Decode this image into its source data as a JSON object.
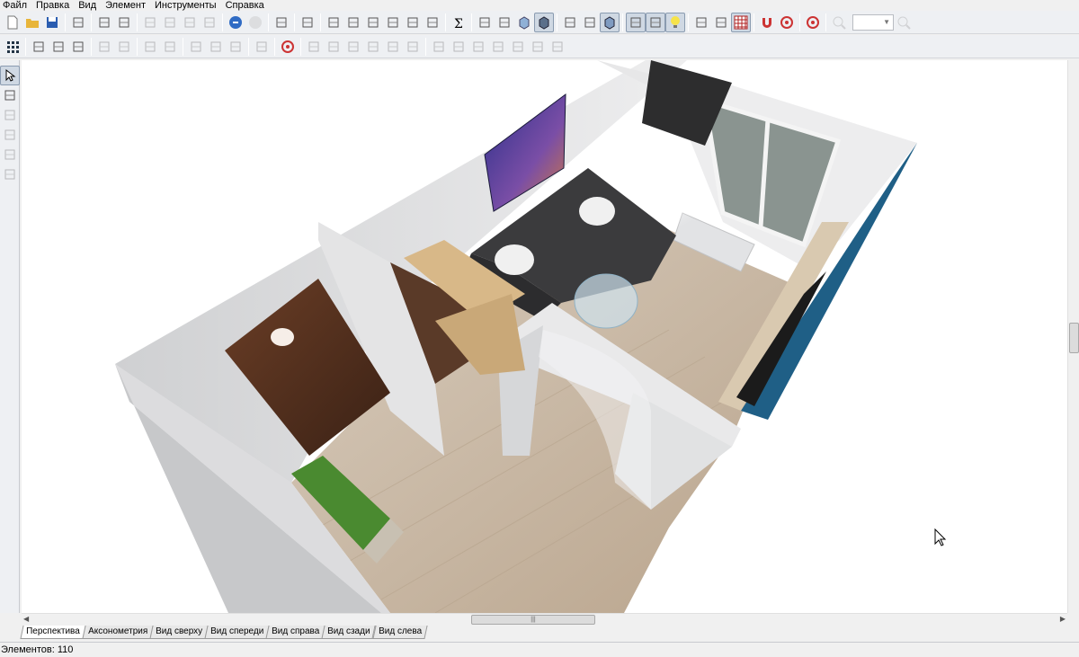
{
  "menu": [
    "Файл",
    "Правка",
    "Вид",
    "Элемент",
    "Инструменты",
    "Справка"
  ],
  "toolbar_main": [
    "new-file-icon",
    "open-folder-icon",
    "save-icon",
    "|",
    "print-preview-icon",
    "|",
    "print-icon",
    "zoom-page-icon",
    "|",
    "cut-icon",
    "copy-icon",
    "paste-icon",
    "delete-icon",
    "|",
    "undo-icon",
    "redo-icon",
    "|",
    "properties-icon",
    "|",
    "checklist-icon",
    "|",
    "view-front-icon",
    "view-find-icon",
    "view-select-icon",
    "view-fit-icon",
    "view-export-icon",
    "view-clock-icon",
    "|",
    "sum-icon",
    "|",
    "box-wire-icon",
    "box-hidden-icon",
    "box-shaded-icon",
    "box-solid-icon",
    "|",
    "cube-wire-icon",
    "cube-hidden-icon",
    "cube-solid-icon",
    "|",
    "texture-text-icon",
    "sphere-material-icon",
    "light-bulb-icon",
    "|",
    "rotate-hand-icon",
    "measure-icon",
    "grid-icon",
    "|",
    "magnet-icon",
    "snap-target-icon",
    "|",
    "compass-icon",
    "|",
    "zoom-out-icon",
    "zoom-combo",
    "zoom-in-icon"
  ],
  "toolbar_edit": [
    "grid-dots-icon",
    "|",
    "move-up-icon",
    "move-object-icon",
    "pencil-icon",
    "|",
    "select-all-icon",
    "group-icon",
    "|",
    "align-icon",
    "mirror-icon",
    "|",
    "rotate-icon",
    "move-cross-icon",
    "warning-icon",
    "|",
    "wall-icon",
    "|",
    "snap-target-icon",
    "|",
    "align-left-icon",
    "align-center-icon",
    "align-top-icon",
    "align-middle-icon",
    "distribute-h-icon",
    "distribute-v-icon",
    "|",
    "align-edge-left-icon",
    "align-edge-center-icon",
    "align-edge-right-icon",
    "align-edge-top-icon",
    "align-edge-bottom-icon",
    "stack-icon",
    "layers-icon"
  ],
  "palette": [
    "pointer-icon",
    "wall-tool-icon",
    "door-tool-icon",
    "window-tool-icon",
    "stairs-tool-icon",
    "zoom-tool-icon"
  ],
  "tabs": [
    "Перспектива",
    "Аксонометрия",
    "Вид сверху",
    "Вид спереди",
    "Вид справа",
    "Вид сзади",
    "Вид слева"
  ],
  "active_tab": 0,
  "status": "Элементов: 110",
  "colors": {
    "wall": "#d9dadc",
    "floor": "#c9b8a3",
    "sofa": "#3b3b3d",
    "door": "#4a2c1c",
    "rug": "#4a8a30",
    "tv_wall": "#1f5f86"
  }
}
